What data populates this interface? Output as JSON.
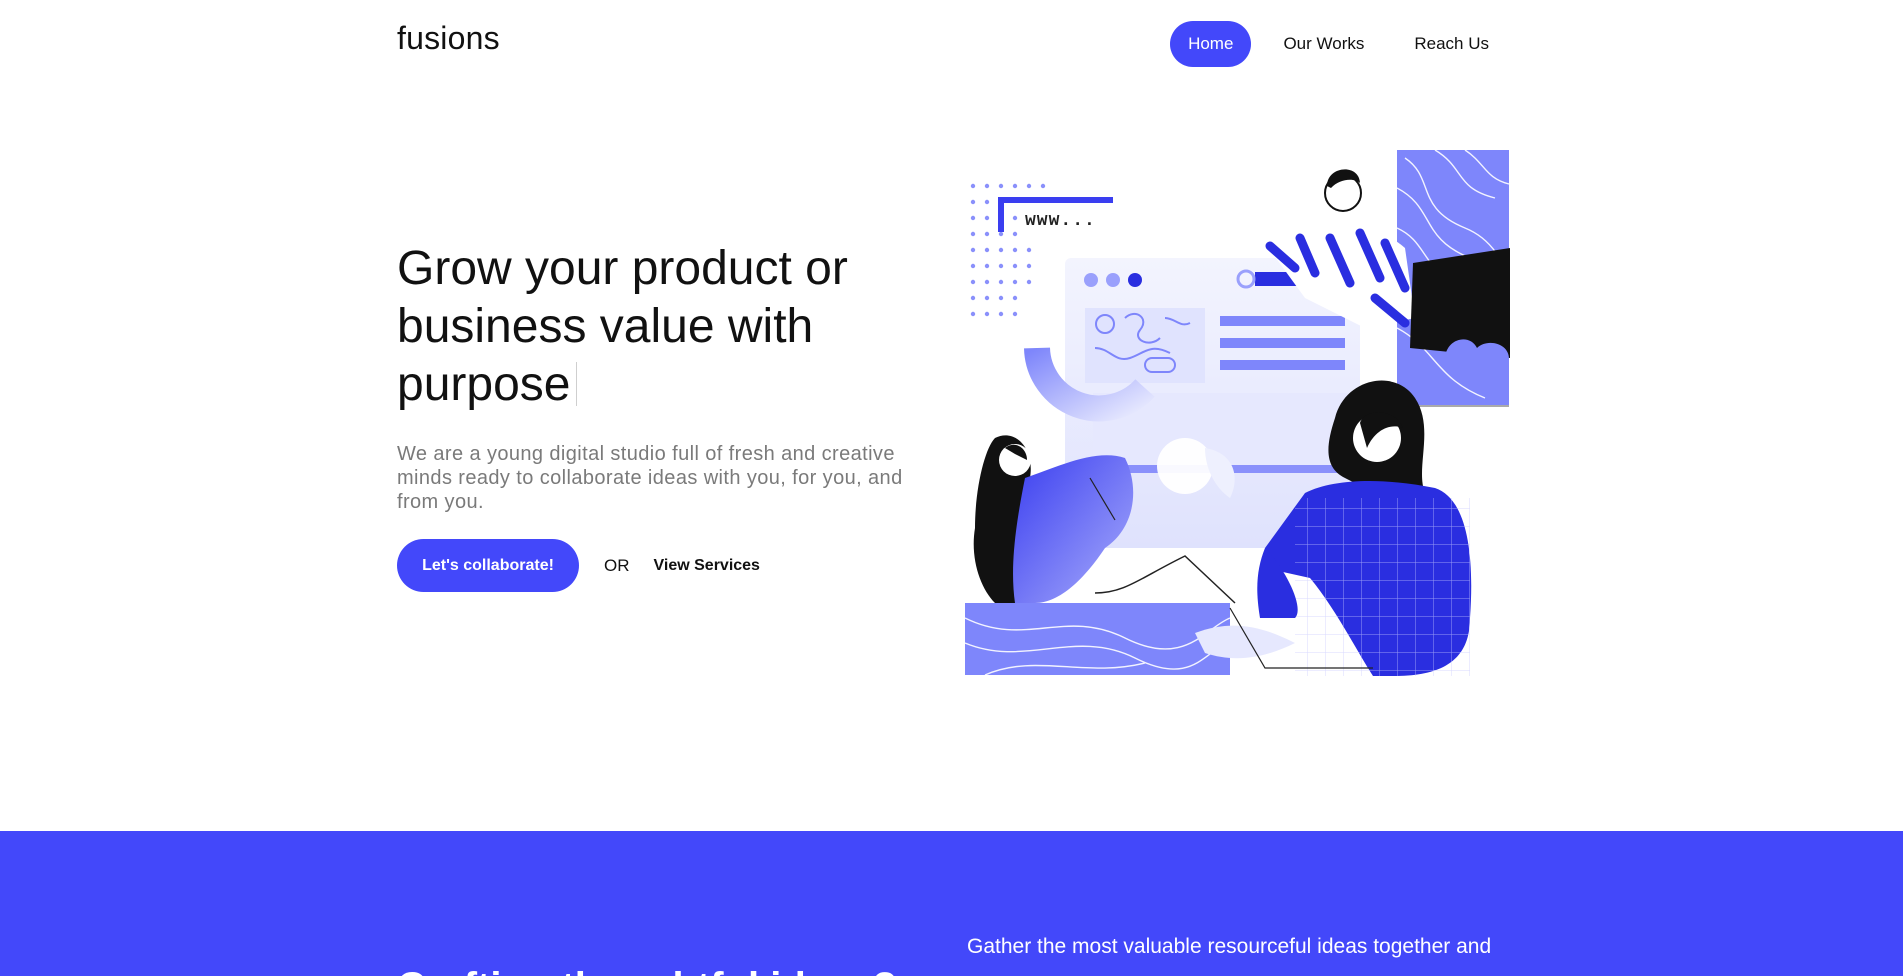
{
  "brand": {
    "name": "fusions"
  },
  "nav": {
    "items": [
      {
        "label": "Home",
        "active": true
      },
      {
        "label": "Our Works",
        "active": false
      },
      {
        "label": "Reach Us",
        "active": false
      }
    ]
  },
  "hero": {
    "title": "Grow your product or business value with purpose",
    "subtitle": "We are a young digital studio full of fresh and creative minds ready to collaborate ideas with you, for you, and from you.",
    "cta_label": "Let's collaborate!",
    "or_text": "OR",
    "secondary_link": "View Services",
    "illustration_text": "www..."
  },
  "section2": {
    "right_text": "Gather the most valuable resourceful ideas together and",
    "left_heading": "Crafting thoughtful ideas?"
  },
  "colors": {
    "accent": "#4348fa",
    "light_accent": "#7e86fb",
    "pale_accent": "#e6e8fe",
    "text": "#111111",
    "muted": "#7a7a7a"
  }
}
